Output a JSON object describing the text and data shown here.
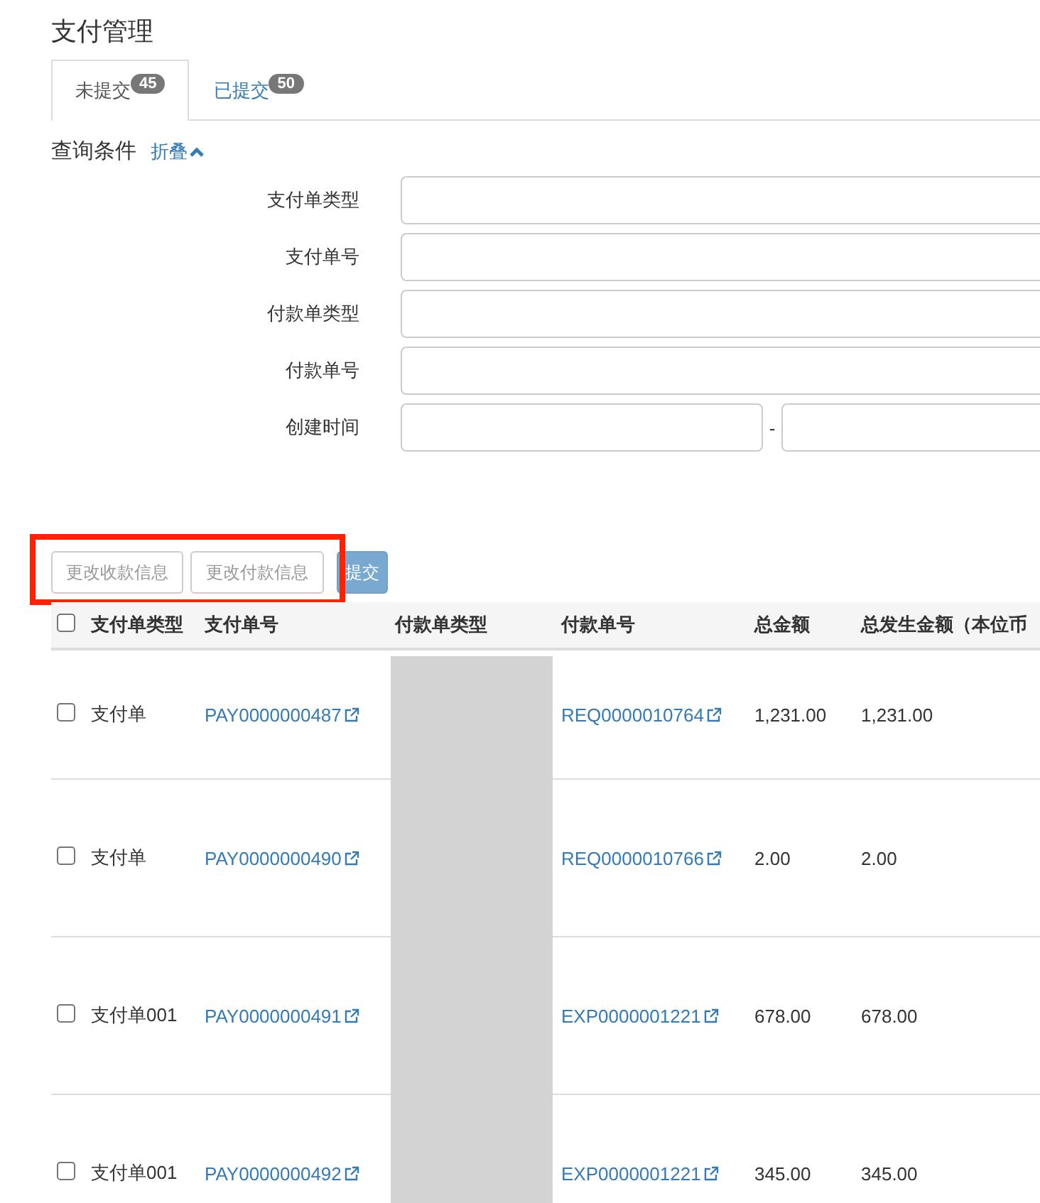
{
  "page_title": "支付管理",
  "tabs": [
    {
      "label": "未提交",
      "count": "45",
      "selected": true
    },
    {
      "label": "已提交",
      "count": "50",
      "selected": false
    }
  ],
  "query": {
    "title": "查询条件",
    "toggle": "折叠",
    "expanded": true
  },
  "form_fields": [
    {
      "label": "支付单类型",
      "kind": "single"
    },
    {
      "label": "支付单号",
      "kind": "single"
    },
    {
      "label": "付款单类型",
      "kind": "single"
    },
    {
      "label": "付款单号",
      "kind": "single"
    },
    {
      "label": "创建时间",
      "kind": "range",
      "separator": "-"
    }
  ],
  "actions": [
    {
      "label": "更改收款信息",
      "kind": "default"
    },
    {
      "label": "更改付款信息",
      "kind": "default"
    },
    {
      "label": "提交",
      "kind": "primary",
      "disabled": true
    }
  ],
  "highlight": {
    "shown": true
  },
  "table": {
    "select_all_checked": false,
    "columns": [
      "支付单类型",
      "支付单号",
      "付款单类型",
      "付款单号",
      "总金额",
      "总发生金额（本位币"
    ],
    "rows": [
      {
        "checked": false,
        "type": "支付单",
        "pay_no": "PAY0000000487",
        "ref_no": "REQ0000010764",
        "total": "1,231.00",
        "local_total": "1,231.00"
      },
      {
        "checked": false,
        "type": "支付单",
        "pay_no": "PAY0000000490",
        "ref_no": "REQ0000010766",
        "total": "2.00",
        "local_total": "2.00"
      },
      {
        "checked": false,
        "type": "支付单001",
        "pay_no": "PAY0000000491",
        "ref_no": "EXP0000001221",
        "total": "678.00",
        "local_total": "678.00"
      },
      {
        "checked": false,
        "type": "支付单001",
        "pay_no": "PAY0000000492",
        "ref_no": "EXP0000001221",
        "total": "345.00",
        "local_total": "345.00"
      }
    ]
  }
}
